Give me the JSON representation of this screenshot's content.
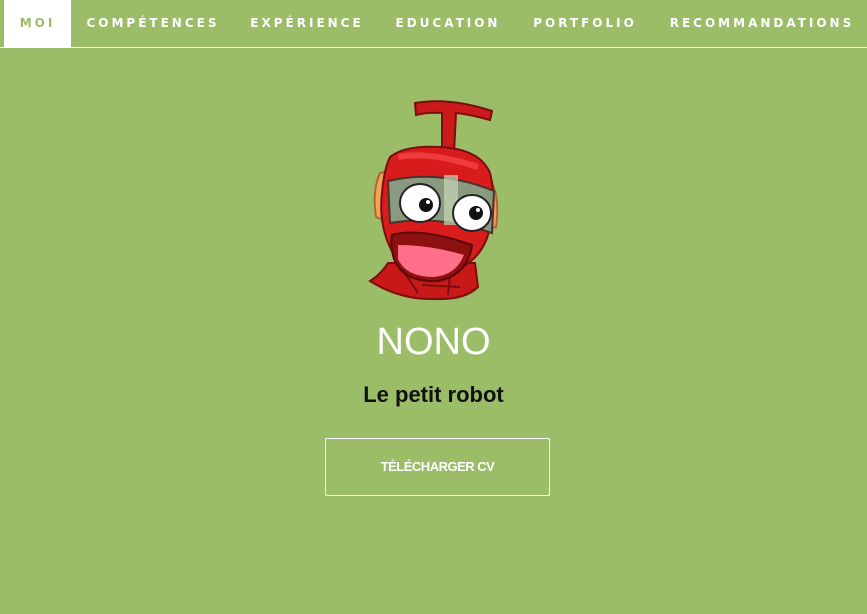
{
  "nav": {
    "items": [
      {
        "label": "MOI",
        "active": true
      },
      {
        "label": "COMPÉTENCES",
        "active": false
      },
      {
        "label": "EXPÉRIENCE",
        "active": false
      },
      {
        "label": "EDUCATION",
        "active": false
      },
      {
        "label": "PORTFOLIO",
        "active": false
      },
      {
        "label": "RECOMMANDATIONS",
        "active": false
      }
    ]
  },
  "profile": {
    "name": "NONO",
    "tagline": "Le petit robot",
    "download_label": "TÉLÉCHARGER CV",
    "avatar_icon": "robot-avatar-icon"
  },
  "colors": {
    "background": "#9bbd68",
    "nav_active_bg": "#ffffff",
    "text": "#ffffff",
    "robot_red": "#d81c1c"
  }
}
